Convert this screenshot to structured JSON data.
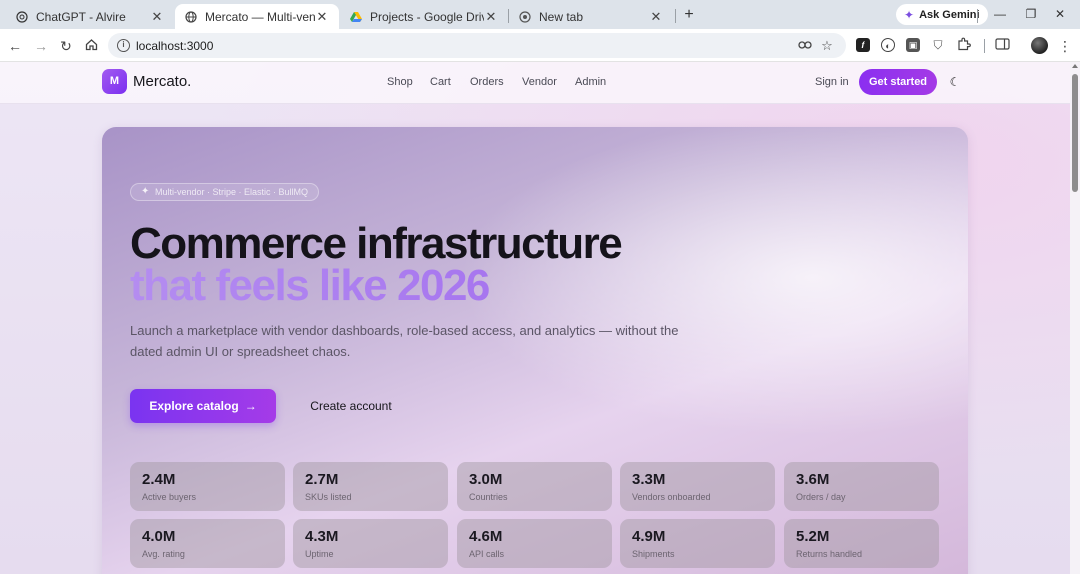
{
  "browser": {
    "tabs": [
      {
        "title": "ChatGPT - Alvire",
        "active": false
      },
      {
        "title": "Mercato — Multi-vendor comm",
        "active": true
      },
      {
        "title": "Projects - Google Drive",
        "active": false
      },
      {
        "title": "New tab",
        "active": false
      }
    ],
    "new_tab_symbol": "+",
    "gemini_label": "Ask Gemini",
    "url": "localhost:3000"
  },
  "site": {
    "logo_letter": "M",
    "brand": "Mercato.",
    "nav": [
      "Shop",
      "Cart",
      "Orders",
      "Vendor",
      "Admin"
    ],
    "sign_in": "Sign in",
    "get_started": "Get started"
  },
  "hero": {
    "pill": "Multi-vendor · Stripe · Elastic · BullMQ",
    "headline_1": "Commerce infrastructure",
    "headline_2": "that feels like 2026",
    "lead": "Launch a marketplace with vendor dashboards, role-based access, and analytics — without the dated admin UI or spreadsheet chaos.",
    "primary_cta": "Explore catalog",
    "secondary_cta": "Create account",
    "stats": [
      {
        "value": "2.4M",
        "label": "Active buyers"
      },
      {
        "value": "2.7M",
        "label": "SKUs listed"
      },
      {
        "value": "3.0M",
        "label": "Countries"
      },
      {
        "value": "3.3M",
        "label": "Vendors onboarded"
      },
      {
        "value": "3.6M",
        "label": "Orders / day"
      },
      {
        "value": "4.0M",
        "label": "Avg. rating"
      },
      {
        "value": "4.3M",
        "label": "Uptime"
      },
      {
        "value": "4.6M",
        "label": "API calls"
      },
      {
        "value": "4.9M",
        "label": "Shipments"
      },
      {
        "value": "5.2M",
        "label": "Returns handled"
      }
    ]
  },
  "colors": {
    "brand_purple": "#8b2ff0",
    "headline_accent": "#b48df0"
  }
}
